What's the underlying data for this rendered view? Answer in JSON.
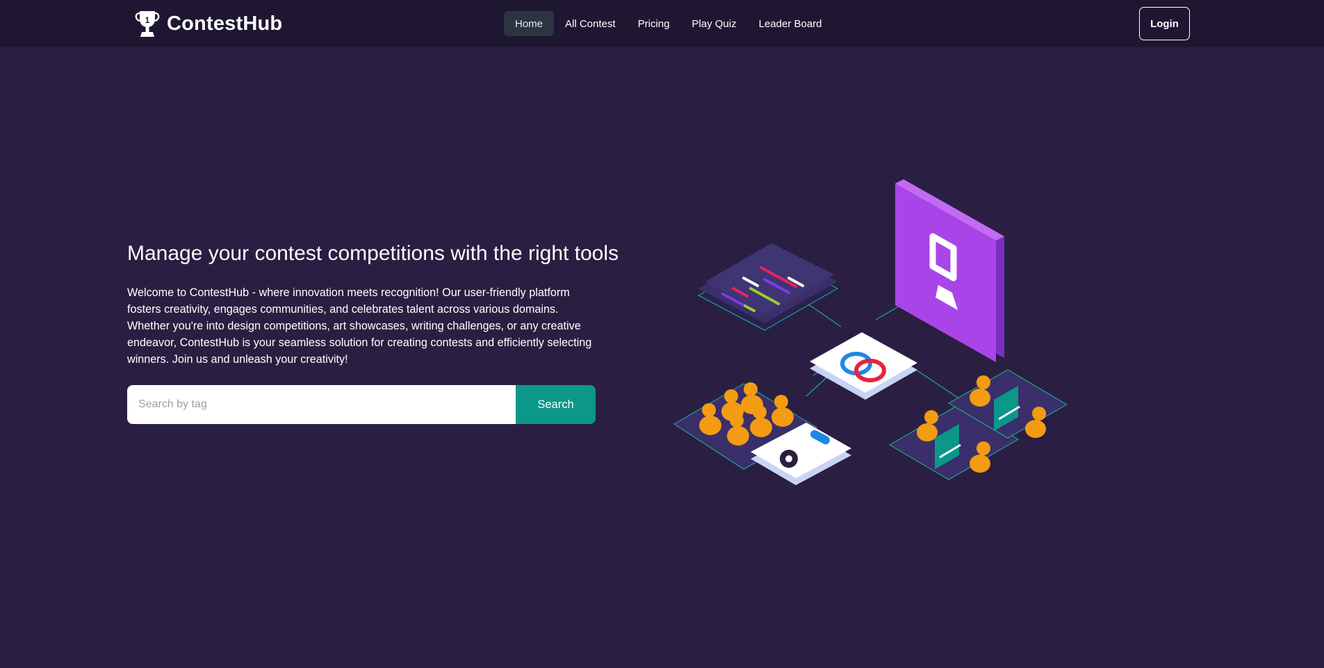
{
  "brand": {
    "name": "ContestHub",
    "icon": "trophy-icon"
  },
  "nav": {
    "links": [
      {
        "label": "Home",
        "active": true
      },
      {
        "label": "All Contest",
        "active": false
      },
      {
        "label": "Pricing",
        "active": false
      },
      {
        "label": "Play Quiz",
        "active": false
      },
      {
        "label": "Leader Board",
        "active": false
      }
    ],
    "login_label": "Login"
  },
  "hero": {
    "title": "Manage your contest competitions with the right tools",
    "description": "Welcome to ContestHub - where innovation meets recognition! Our user-friendly platform fosters creativity, engages communities, and celebrates talent across various domains. Whether you're into design competitions, art showcases, writing challenges, or any creative endeavor, ContestHub is your seamless solution for creating contests and efficiently selecting winners. Join us and unleash your creativity!",
    "search": {
      "placeholder": "Search by tag",
      "value": "",
      "button_label": "Search"
    }
  },
  "colors": {
    "background": "#2a1f42",
    "navbar": "#1f1731",
    "accent": "#0b978a",
    "active_tab": "#2d3441"
  }
}
